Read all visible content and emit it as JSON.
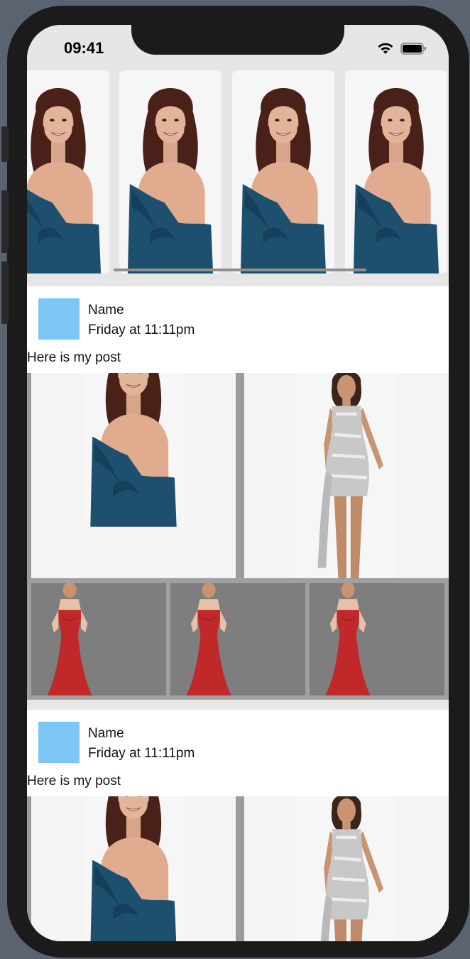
{
  "status_bar": {
    "time": "09:41"
  },
  "icons": {
    "wifi": "wifi-icon",
    "battery": "battery-icon"
  },
  "colors": {
    "avatar": "#7bc6f4",
    "dress_blue": "#1d4f6e",
    "dress_red": "#c0282a"
  },
  "stories": [
    {
      "image": "woman-blue-dress"
    },
    {
      "image": "woman-blue-dress"
    },
    {
      "image": "woman-blue-dress"
    },
    {
      "image": "woman-blue-dress"
    }
  ],
  "posts": [
    {
      "name": "Name",
      "time": "Friday at 11:11pm",
      "text": "Here is my post",
      "images_large": [
        "woman-blue-dress",
        "woman-silver-dress"
      ],
      "images_small": [
        "woman-red-gown",
        "woman-red-gown",
        "woman-red-gown"
      ]
    },
    {
      "name": "Name",
      "time": "Friday at 11:11pm",
      "text": "Here is my post",
      "images_large": [
        "woman-blue-dress",
        "woman-silver-dress"
      ]
    }
  ]
}
